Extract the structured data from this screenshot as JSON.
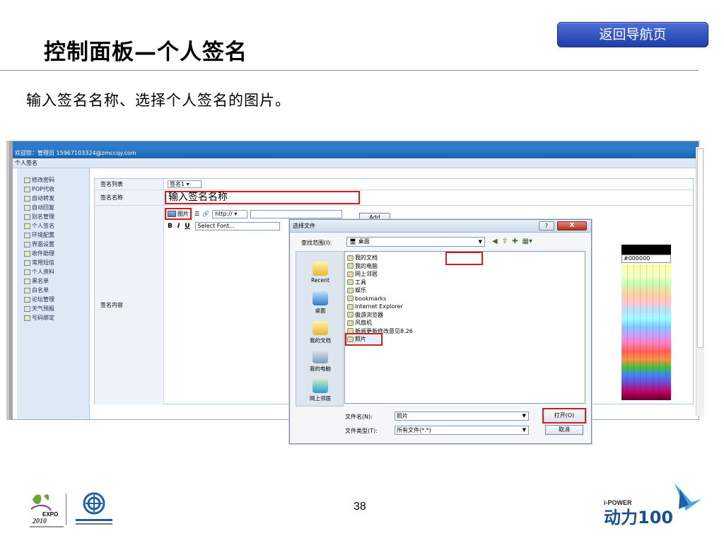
{
  "slide": {
    "title": "控制面板—个人签名",
    "nav_button": "返回导航页",
    "subtitle": "输入签名名称、选择个人签名的图片。",
    "page_number": "38"
  },
  "app": {
    "welcome": "欢迎您：管理员 15967103324@zmccqy.com",
    "tab": "个人签名",
    "sidebar": [
      {
        "label": "修改密码",
        "icon": "key-icon"
      },
      {
        "label": "POP代收",
        "icon": "pop-icon"
      },
      {
        "label": "自动转发",
        "icon": "forward-icon"
      },
      {
        "label": "自动回复",
        "icon": "reply-icon"
      },
      {
        "label": "别名管理",
        "icon": "alias-icon"
      },
      {
        "label": "个人签名",
        "icon": "signature-icon"
      },
      {
        "label": "环境配置",
        "icon": "settings-icon"
      },
      {
        "label": "界面设置",
        "icon": "interface-icon"
      },
      {
        "label": "收件助理",
        "icon": "assistant-icon"
      },
      {
        "label": "常用短信",
        "icon": "sms-icon"
      },
      {
        "label": "个人资料",
        "icon": "profile-icon"
      },
      {
        "label": "黑名单",
        "icon": "blacklist-icon"
      },
      {
        "label": "白名单",
        "icon": "whitelist-icon"
      },
      {
        "label": "论坛管理",
        "icon": "forum-icon"
      },
      {
        "label": "天气预报",
        "icon": "weather-icon"
      },
      {
        "label": "号码绑定",
        "icon": "bind-icon"
      }
    ],
    "form": {
      "list_label": "签名列表",
      "list_value": "签名1",
      "name_label": "签名名称",
      "name_value": "输入签名名称",
      "content_label": "签名内容",
      "image_button": "图片",
      "url_value": "http://",
      "add_button": "Add",
      "bold": "B",
      "italic": "I",
      "underline": "U",
      "font_select": "Select Font...",
      "color_value": "#000000"
    }
  },
  "dialog": {
    "title": "选择文件",
    "look_in_label": "查找范围(I):",
    "look_in_value": "桌面",
    "places": [
      "Recent",
      "桌面",
      "我的文档",
      "我的电脑",
      "网上邻居"
    ],
    "files": [
      "我的文档",
      "我的电脑",
      "网上邻居",
      "工具",
      "娱乐",
      "bookmarks",
      "Internet Explorer",
      "傲游浏览器",
      "风扇机",
      "新闻更新修改意见8.26",
      "照片"
    ],
    "filename_label": "文件名(N):",
    "filename_value": "照片",
    "filetype_label": "文件类型(T):",
    "filetype_value": "所有文件(*.*)",
    "open_button": "打开(O)",
    "cancel_button": "取消",
    "help_button": "?",
    "close_button": "X"
  },
  "logos": {
    "expo_text": "EXPO",
    "expo_year": "2010",
    "power_text": "i-POWER",
    "power_brand": "动力100"
  },
  "colors": {
    "nav_blue": "#2343b3",
    "highlight_red": "#d21b1b",
    "app_header": "#1d63ad"
  }
}
